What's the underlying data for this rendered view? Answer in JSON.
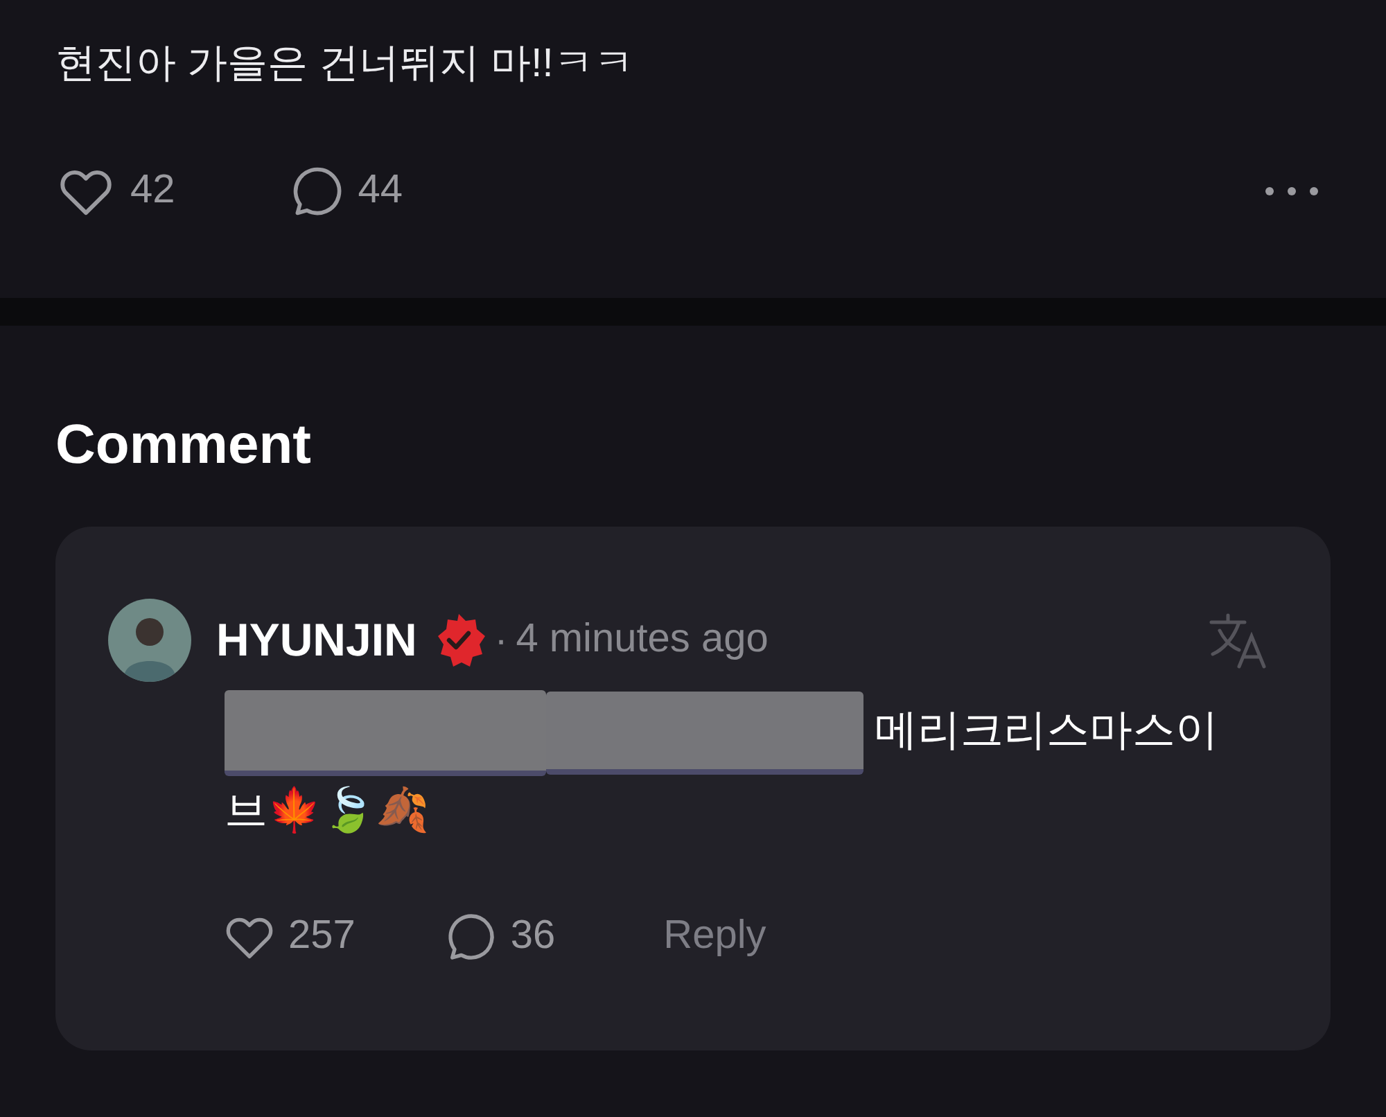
{
  "post": {
    "text": "현진아 가을은 건너뛰지 마!!ㅋㅋ",
    "likes": "42",
    "comments": "44"
  },
  "comments_section": {
    "title": "Comment",
    "comment": {
      "author": "HYUNJIN",
      "verified": true,
      "separator": "·",
      "time": "4 minutes ago",
      "text": "메리크리스마스이브🍁🍃🍂",
      "likes": "257",
      "replies": "36",
      "reply_label": "Reply"
    }
  }
}
